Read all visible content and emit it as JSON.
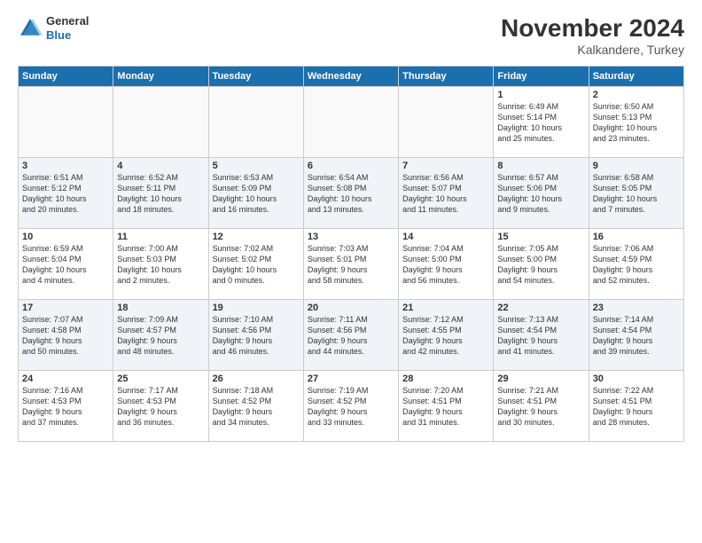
{
  "logo": {
    "general": "General",
    "blue": "Blue"
  },
  "header": {
    "month": "November 2024",
    "location": "Kalkandere, Turkey"
  },
  "weekdays": [
    "Sunday",
    "Monday",
    "Tuesday",
    "Wednesday",
    "Thursday",
    "Friday",
    "Saturday"
  ],
  "weeks": [
    [
      {
        "day": "",
        "info": ""
      },
      {
        "day": "",
        "info": ""
      },
      {
        "day": "",
        "info": ""
      },
      {
        "day": "",
        "info": ""
      },
      {
        "day": "",
        "info": ""
      },
      {
        "day": "1",
        "info": "Sunrise: 6:49 AM\nSunset: 5:14 PM\nDaylight: 10 hours\nand 25 minutes."
      },
      {
        "day": "2",
        "info": "Sunrise: 6:50 AM\nSunset: 5:13 PM\nDaylight: 10 hours\nand 23 minutes."
      }
    ],
    [
      {
        "day": "3",
        "info": "Sunrise: 6:51 AM\nSunset: 5:12 PM\nDaylight: 10 hours\nand 20 minutes."
      },
      {
        "day": "4",
        "info": "Sunrise: 6:52 AM\nSunset: 5:11 PM\nDaylight: 10 hours\nand 18 minutes."
      },
      {
        "day": "5",
        "info": "Sunrise: 6:53 AM\nSunset: 5:09 PM\nDaylight: 10 hours\nand 16 minutes."
      },
      {
        "day": "6",
        "info": "Sunrise: 6:54 AM\nSunset: 5:08 PM\nDaylight: 10 hours\nand 13 minutes."
      },
      {
        "day": "7",
        "info": "Sunrise: 6:56 AM\nSunset: 5:07 PM\nDaylight: 10 hours\nand 11 minutes."
      },
      {
        "day": "8",
        "info": "Sunrise: 6:57 AM\nSunset: 5:06 PM\nDaylight: 10 hours\nand 9 minutes."
      },
      {
        "day": "9",
        "info": "Sunrise: 6:58 AM\nSunset: 5:05 PM\nDaylight: 10 hours\nand 7 minutes."
      }
    ],
    [
      {
        "day": "10",
        "info": "Sunrise: 6:59 AM\nSunset: 5:04 PM\nDaylight: 10 hours\nand 4 minutes."
      },
      {
        "day": "11",
        "info": "Sunrise: 7:00 AM\nSunset: 5:03 PM\nDaylight: 10 hours\nand 2 minutes."
      },
      {
        "day": "12",
        "info": "Sunrise: 7:02 AM\nSunset: 5:02 PM\nDaylight: 10 hours\nand 0 minutes."
      },
      {
        "day": "13",
        "info": "Sunrise: 7:03 AM\nSunset: 5:01 PM\nDaylight: 9 hours\nand 58 minutes."
      },
      {
        "day": "14",
        "info": "Sunrise: 7:04 AM\nSunset: 5:00 PM\nDaylight: 9 hours\nand 56 minutes."
      },
      {
        "day": "15",
        "info": "Sunrise: 7:05 AM\nSunset: 5:00 PM\nDaylight: 9 hours\nand 54 minutes."
      },
      {
        "day": "16",
        "info": "Sunrise: 7:06 AM\nSunset: 4:59 PM\nDaylight: 9 hours\nand 52 minutes."
      }
    ],
    [
      {
        "day": "17",
        "info": "Sunrise: 7:07 AM\nSunset: 4:58 PM\nDaylight: 9 hours\nand 50 minutes."
      },
      {
        "day": "18",
        "info": "Sunrise: 7:09 AM\nSunset: 4:57 PM\nDaylight: 9 hours\nand 48 minutes."
      },
      {
        "day": "19",
        "info": "Sunrise: 7:10 AM\nSunset: 4:56 PM\nDaylight: 9 hours\nand 46 minutes."
      },
      {
        "day": "20",
        "info": "Sunrise: 7:11 AM\nSunset: 4:56 PM\nDaylight: 9 hours\nand 44 minutes."
      },
      {
        "day": "21",
        "info": "Sunrise: 7:12 AM\nSunset: 4:55 PM\nDaylight: 9 hours\nand 42 minutes."
      },
      {
        "day": "22",
        "info": "Sunrise: 7:13 AM\nSunset: 4:54 PM\nDaylight: 9 hours\nand 41 minutes."
      },
      {
        "day": "23",
        "info": "Sunrise: 7:14 AM\nSunset: 4:54 PM\nDaylight: 9 hours\nand 39 minutes."
      }
    ],
    [
      {
        "day": "24",
        "info": "Sunrise: 7:16 AM\nSunset: 4:53 PM\nDaylight: 9 hours\nand 37 minutes."
      },
      {
        "day": "25",
        "info": "Sunrise: 7:17 AM\nSunset: 4:53 PM\nDaylight: 9 hours\nand 36 minutes."
      },
      {
        "day": "26",
        "info": "Sunrise: 7:18 AM\nSunset: 4:52 PM\nDaylight: 9 hours\nand 34 minutes."
      },
      {
        "day": "27",
        "info": "Sunrise: 7:19 AM\nSunset: 4:52 PM\nDaylight: 9 hours\nand 33 minutes."
      },
      {
        "day": "28",
        "info": "Sunrise: 7:20 AM\nSunset: 4:51 PM\nDaylight: 9 hours\nand 31 minutes."
      },
      {
        "day": "29",
        "info": "Sunrise: 7:21 AM\nSunset: 4:51 PM\nDaylight: 9 hours\nand 30 minutes."
      },
      {
        "day": "30",
        "info": "Sunrise: 7:22 AM\nSunset: 4:51 PM\nDaylight: 9 hours\nand 28 minutes."
      }
    ]
  ]
}
